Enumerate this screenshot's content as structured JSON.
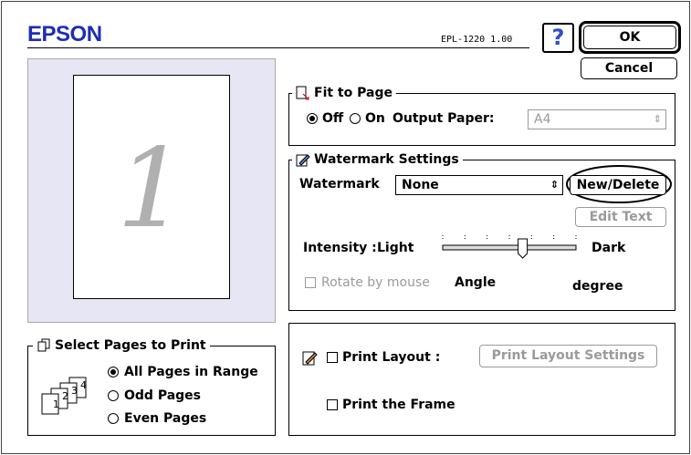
{
  "header": {
    "brand": "EPSON",
    "model": "EPL-1220  1.00",
    "help": "?"
  },
  "buttons": {
    "ok": "OK",
    "cancel": "Cancel"
  },
  "preview": {
    "page_number": "1"
  },
  "fit_to_page": {
    "title": "Fit to Page",
    "off_label": "Off",
    "on_label": "On",
    "selected": "Off",
    "output_paper_label": "Output Paper:",
    "output_paper_value": "A4"
  },
  "watermark": {
    "title": "Watermark Settings",
    "watermark_label": "Watermark",
    "watermark_value": "None",
    "new_delete": "New/Delete",
    "edit_text": "Edit Text",
    "intensity_label": "Intensity :",
    "light": "Light",
    "dark": "Dark",
    "intensity_level": 0.6,
    "rotate_label": "Rotate by mouse",
    "angle_label": "Angle",
    "degree_label": "degree"
  },
  "select_pages": {
    "title": "Select Pages to Print",
    "options": [
      "All Pages in Range",
      "Odd Pages",
      "Even Pages"
    ],
    "selected": "All Pages in Range"
  },
  "layout": {
    "print_layout_label": "Print Layout :",
    "print_layout_settings": "Print Layout Settings",
    "print_frame_label": "Print the Frame"
  },
  "colors": {
    "brand": "#1e2db4",
    "preview_bg": "#e6e6f5",
    "disabled": "#9a9a9a"
  }
}
